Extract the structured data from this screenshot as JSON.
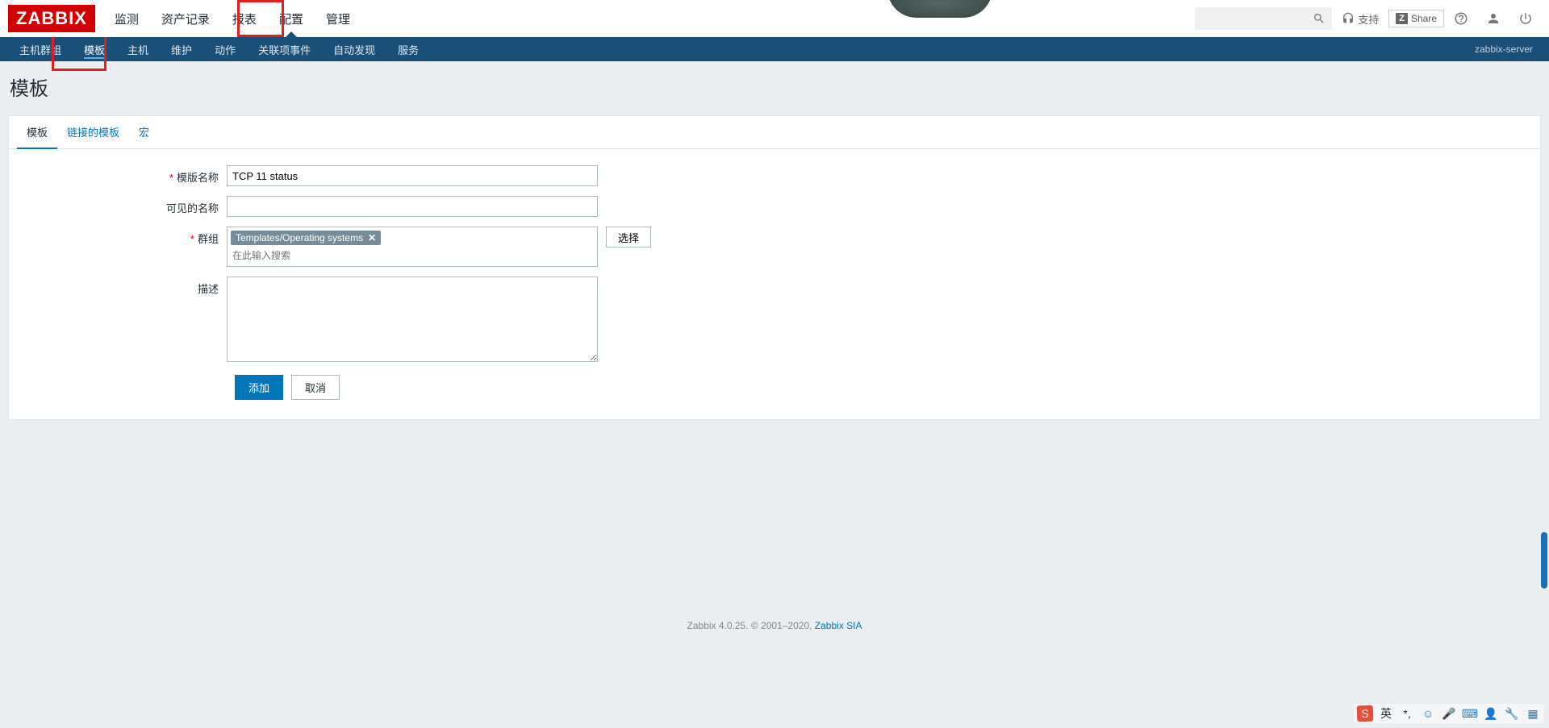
{
  "logo": "ZABBIX",
  "top_menu": [
    "监测",
    "资产记录",
    "报表",
    "配置",
    "管理"
  ],
  "top_menu_active_index": 3,
  "search_placeholder": "",
  "support_label": "支持",
  "share_label": "Share",
  "sub_menu": [
    "主机群组",
    "模板",
    "主机",
    "维护",
    "动作",
    "关联项事件",
    "自动发现",
    "服务"
  ],
  "sub_menu_active_index": 1,
  "server_name": "zabbix-server",
  "page_title": "模板",
  "tabs": [
    "模板",
    "链接的模板",
    "宏"
  ],
  "tabs_active_index": 0,
  "form": {
    "template_name_label": "模版名称",
    "template_name_value": "TCP 11 status",
    "visible_name_label": "可见的名称",
    "visible_name_value": "",
    "groups_label": "群组",
    "groups_tag": "Templates/Operating systems",
    "groups_placeholder": "在此输入搜索",
    "select_button": "选择",
    "description_label": "描述",
    "description_value": "",
    "add_button": "添加",
    "cancel_button": "取消"
  },
  "footer": {
    "text": "Zabbix 4.0.25. © 2001–2020, ",
    "link": "Zabbix SIA"
  },
  "taskbar_lang": "英"
}
